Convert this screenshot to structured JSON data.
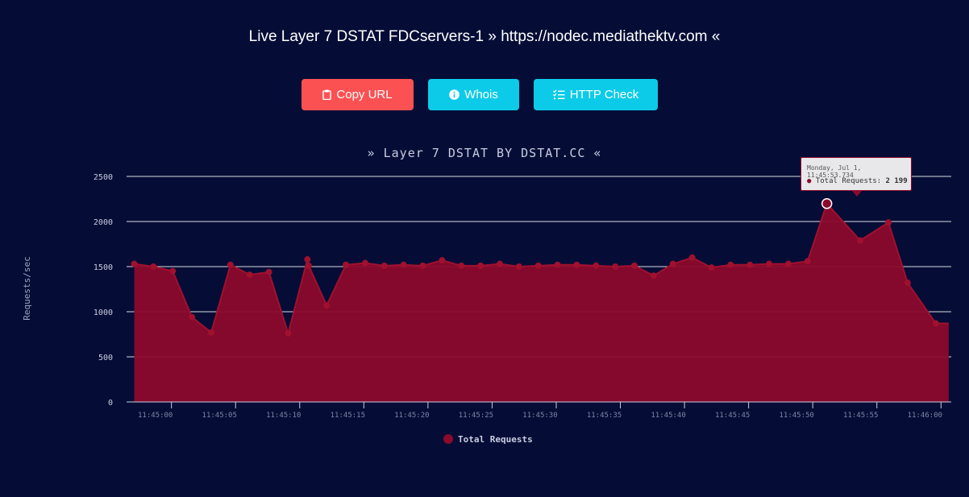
{
  "header": {
    "title": "Live Layer 7 DSTAT FDCservers-1 » https://nodec.mediathektv.com «"
  },
  "buttons": {
    "copy_url": "Copy URL",
    "whois": "Whois",
    "http_check": "HTTP Check"
  },
  "icons": {
    "copy": "clipboard-icon",
    "whois": "info-circle-icon",
    "http_check": "checklist-icon"
  },
  "colors": {
    "background": "#050d36",
    "series": "#8b0a2c",
    "copy_button": "#fb5153",
    "info_button": "#0ccbe8"
  },
  "chart_data": {
    "type": "area",
    "title": "» Layer 7 DSTAT BY DSTAT.CC «",
    "xlabel": "",
    "ylabel": "Requests/sec",
    "ylim": [
      0,
      2500
    ],
    "xlim": [
      "11:44:56.5",
      "11:46:00.8"
    ],
    "grid": true,
    "legend_position": "bottom",
    "yticks": [
      "0",
      "500",
      "1000",
      "1500",
      "2000",
      "2500"
    ],
    "xticks": [
      "11:45:00",
      "11:45:05",
      "11:45:10",
      "11:45:15",
      "11:45:20",
      "11:45:25",
      "11:45:30",
      "11:45:35",
      "11:45:40",
      "11:45:45",
      "11:45:50",
      "11:45:55",
      "11:46:00"
    ],
    "series": [
      {
        "name": "Total Requests",
        "x": [
          57.1,
          58.6,
          60.1,
          61.6,
          63.1,
          64.6,
          66.1,
          67.6,
          69.1,
          70.6,
          70.7,
          72.1,
          73.6,
          75.1,
          76.6,
          78.1,
          79.6,
          81.1,
          82.6,
          84.1,
          85.6,
          87.1,
          88.6,
          90.1,
          91.6,
          93.1,
          94.6,
          96.1,
          97.6,
          99.1,
          100.6,
          102.1,
          103.6,
          105.1,
          106.6,
          108.1,
          109.6,
          111.1,
          113.7,
          115.9,
          117.4,
          119.6,
          120.6
        ],
        "y": [
          1530,
          1500,
          1450,
          940,
          770,
          1520,
          1410,
          1440,
          760,
          1580,
          1510,
          1070,
          1520,
          1540,
          1510,
          1520,
          1510,
          1570,
          1510,
          1510,
          1530,
          1500,
          1510,
          1520,
          1520,
          1510,
          1500,
          1510,
          1400,
          1530,
          1600,
          1490,
          1520,
          1520,
          1530,
          1530,
          1560,
          2199,
          1790,
          1990,
          1320,
          870,
          870
        ]
      }
    ],
    "tooltip": {
      "time": "Monday, Jul 1, 11:45:53.734",
      "series": "Total Requests",
      "value": "2 199",
      "point_index": 37
    }
  }
}
